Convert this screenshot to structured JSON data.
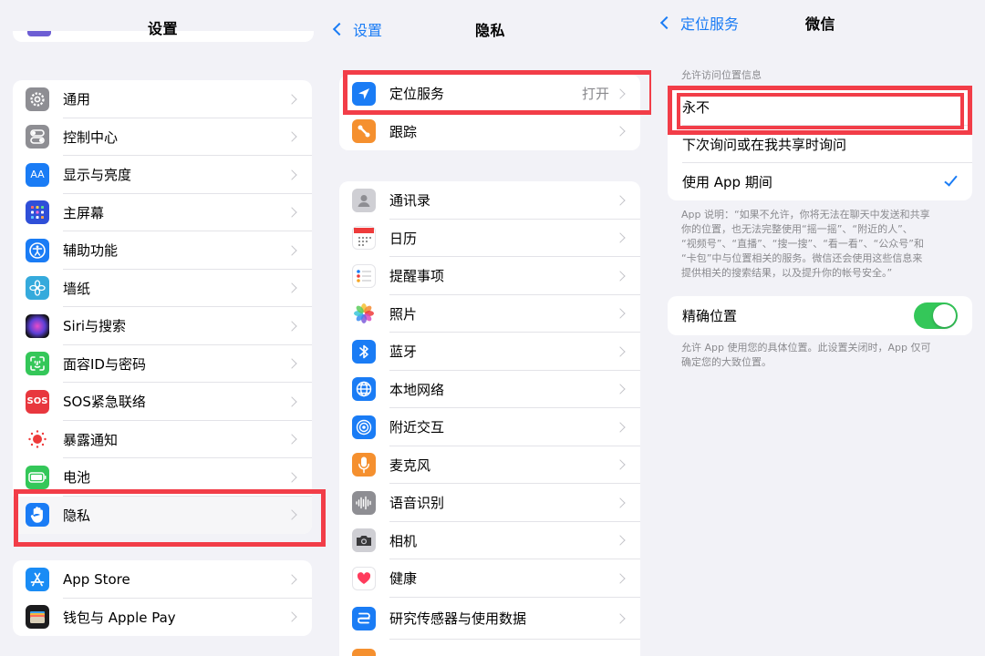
{
  "colors": {
    "accent": "#1a7cf5",
    "highlight": "#f23d48",
    "toggle_on": "#34c759"
  },
  "settings": {
    "title": "设置",
    "group1": [
      {
        "label": "通用",
        "icon": "gear-icon"
      },
      {
        "label": "控制中心",
        "icon": "toggles-icon"
      },
      {
        "label": "显示与亮度",
        "icon": "text-size-icon",
        "glyph": "AA"
      },
      {
        "label": "主屏幕",
        "icon": "home-grid-icon"
      },
      {
        "label": "辅助功能",
        "icon": "accessibility-icon"
      },
      {
        "label": "墙纸",
        "icon": "flower-icon"
      },
      {
        "label": "Siri与搜索",
        "icon": "siri-icon"
      },
      {
        "label": "面容ID与密码",
        "icon": "face-id-icon"
      },
      {
        "label": "SOS紧急联络",
        "icon": "sos-icon",
        "glyph": "SOS"
      },
      {
        "label": "暴露通知",
        "icon": "exposure-icon"
      },
      {
        "label": "电池",
        "icon": "battery-icon"
      },
      {
        "label": "隐私",
        "icon": "hand-icon"
      }
    ],
    "group2": [
      {
        "label": "App Store",
        "icon": "app-store-icon"
      },
      {
        "label": "钱包与 Apple Pay",
        "icon": "wallet-icon"
      }
    ]
  },
  "privacy": {
    "back": "设置",
    "title": "隐私",
    "group1": [
      {
        "label": "定位服务",
        "value": "打开",
        "icon": "location-arrow-icon"
      },
      {
        "label": "跟踪",
        "icon": "tracking-icon"
      }
    ],
    "group2": [
      {
        "label": "通讯录",
        "icon": "contacts-icon"
      },
      {
        "label": "日历",
        "icon": "calendar-icon"
      },
      {
        "label": "提醒事项",
        "icon": "reminders-icon"
      },
      {
        "label": "照片",
        "icon": "photos-icon"
      },
      {
        "label": "蓝牙",
        "icon": "bluetooth-icon"
      },
      {
        "label": "本地网络",
        "icon": "globe-icon"
      },
      {
        "label": "附近交互",
        "icon": "nearby-icon"
      },
      {
        "label": "麦克风",
        "icon": "microphone-icon"
      },
      {
        "label": "语音识别",
        "icon": "waveform-icon"
      },
      {
        "label": "相机",
        "icon": "camera-icon"
      },
      {
        "label": "健康",
        "icon": "heart-icon"
      },
      {
        "label": "研究传感器与使用数据",
        "icon": "research-icon"
      }
    ]
  },
  "wechat": {
    "back": "定位服务",
    "title": "微信",
    "section_label": "允许访问位置信息",
    "options": [
      {
        "label": "永不",
        "checked": false
      },
      {
        "label": "下次询问或在我共享时询问",
        "checked": false
      },
      {
        "label": "使用 App 期间",
        "checked": true
      }
    ],
    "note_lines": [
      "App 说明：“如果不允许，你将无法在聊天中发送和共享",
      "你的位置，也无法完整使用“摇一摇”、“附近的人”、",
      "“视频号”、“直播”、“搜一搜”、“看一看”、“公众号”和",
      "“卡包”中与位置相关的服务。微信还会使用这些信息来",
      "提供相关的搜索结果，以及提升你的帐号安全。”"
    ],
    "precise_label": "精确位置",
    "precise_on": true,
    "precise_note_lines": [
      "允许 App 使用您的具体位置。此设置关闭时，App 仅可",
      "确定您的大致位置。"
    ]
  }
}
